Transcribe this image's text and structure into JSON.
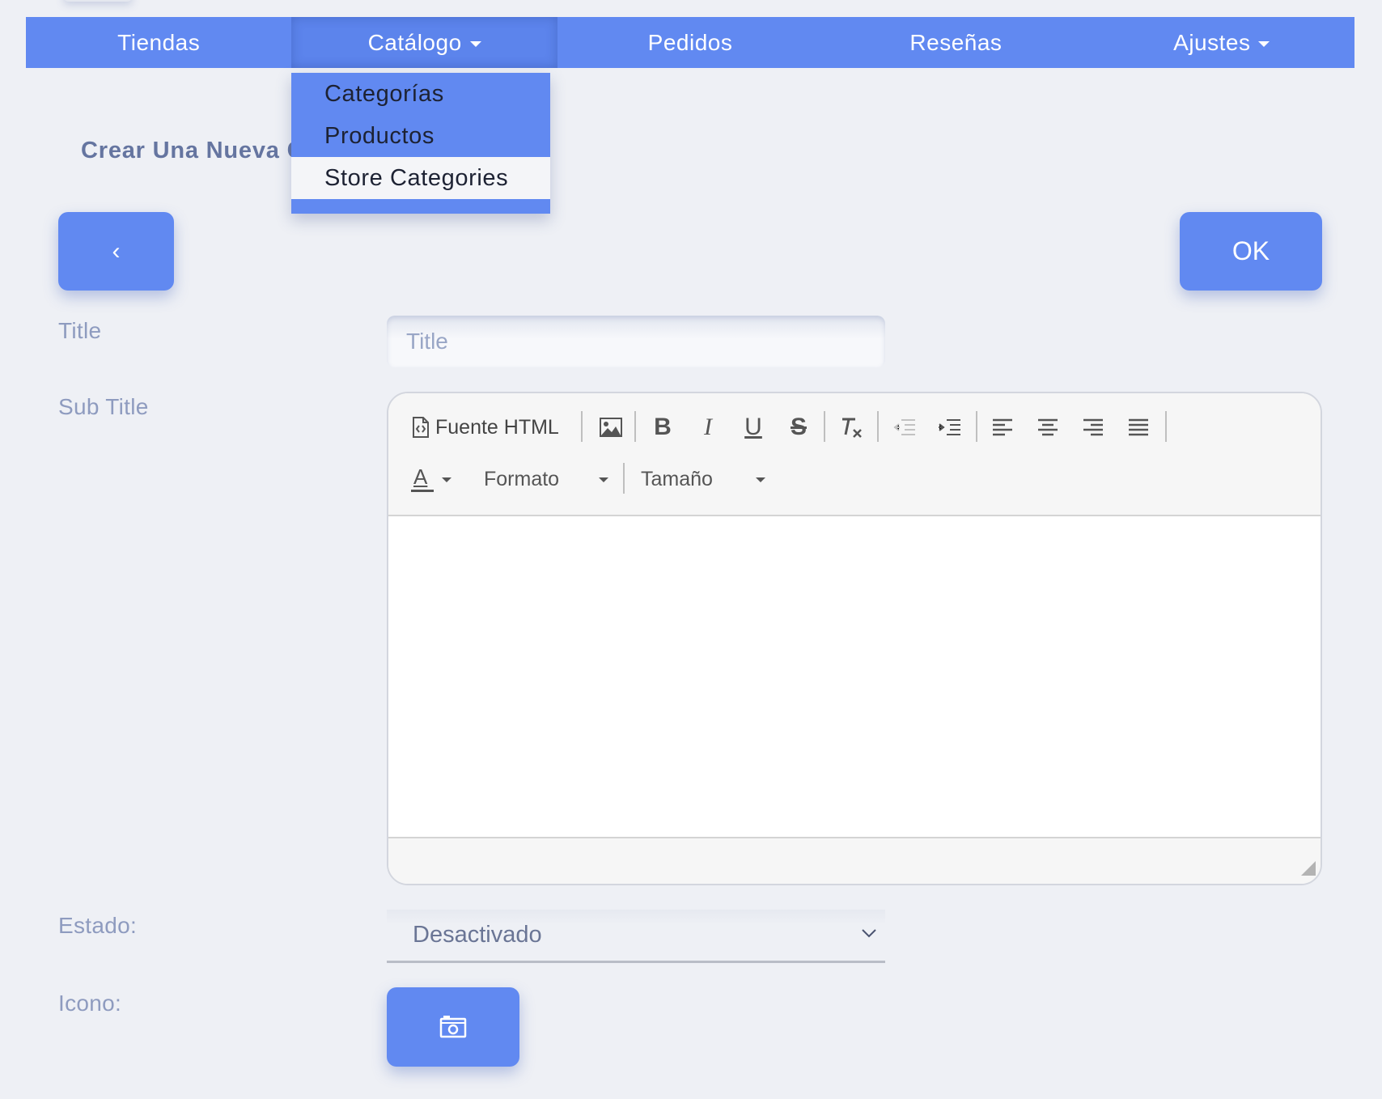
{
  "nav": {
    "items": [
      {
        "label": "Tiendas"
      },
      {
        "label": "Catálogo"
      },
      {
        "label": "Pedidos"
      },
      {
        "label": "Reseñas"
      },
      {
        "label": "Ajustes"
      }
    ]
  },
  "dropdown": {
    "items": [
      {
        "label": "Categorías"
      },
      {
        "label": "Productos"
      },
      {
        "label": "Store Categories"
      }
    ]
  },
  "page": {
    "heading": "Crear Una Nueva C",
    "back_label": "‹",
    "ok_label": "OK"
  },
  "form": {
    "title_label": "Title",
    "title_placeholder": "Title",
    "subtitle_label": "Sub Title",
    "status_label": "Estado:",
    "status_value": "Desactivado",
    "icon_label": "Icono:"
  },
  "editor": {
    "source_label": "Fuente HTML",
    "format_label": "Formato",
    "size_label": "Tamaño",
    "color_glyph": "A"
  },
  "colors": {
    "accent": "#6189f1",
    "background": "#eef0f5",
    "label": "#8e9bbf"
  }
}
